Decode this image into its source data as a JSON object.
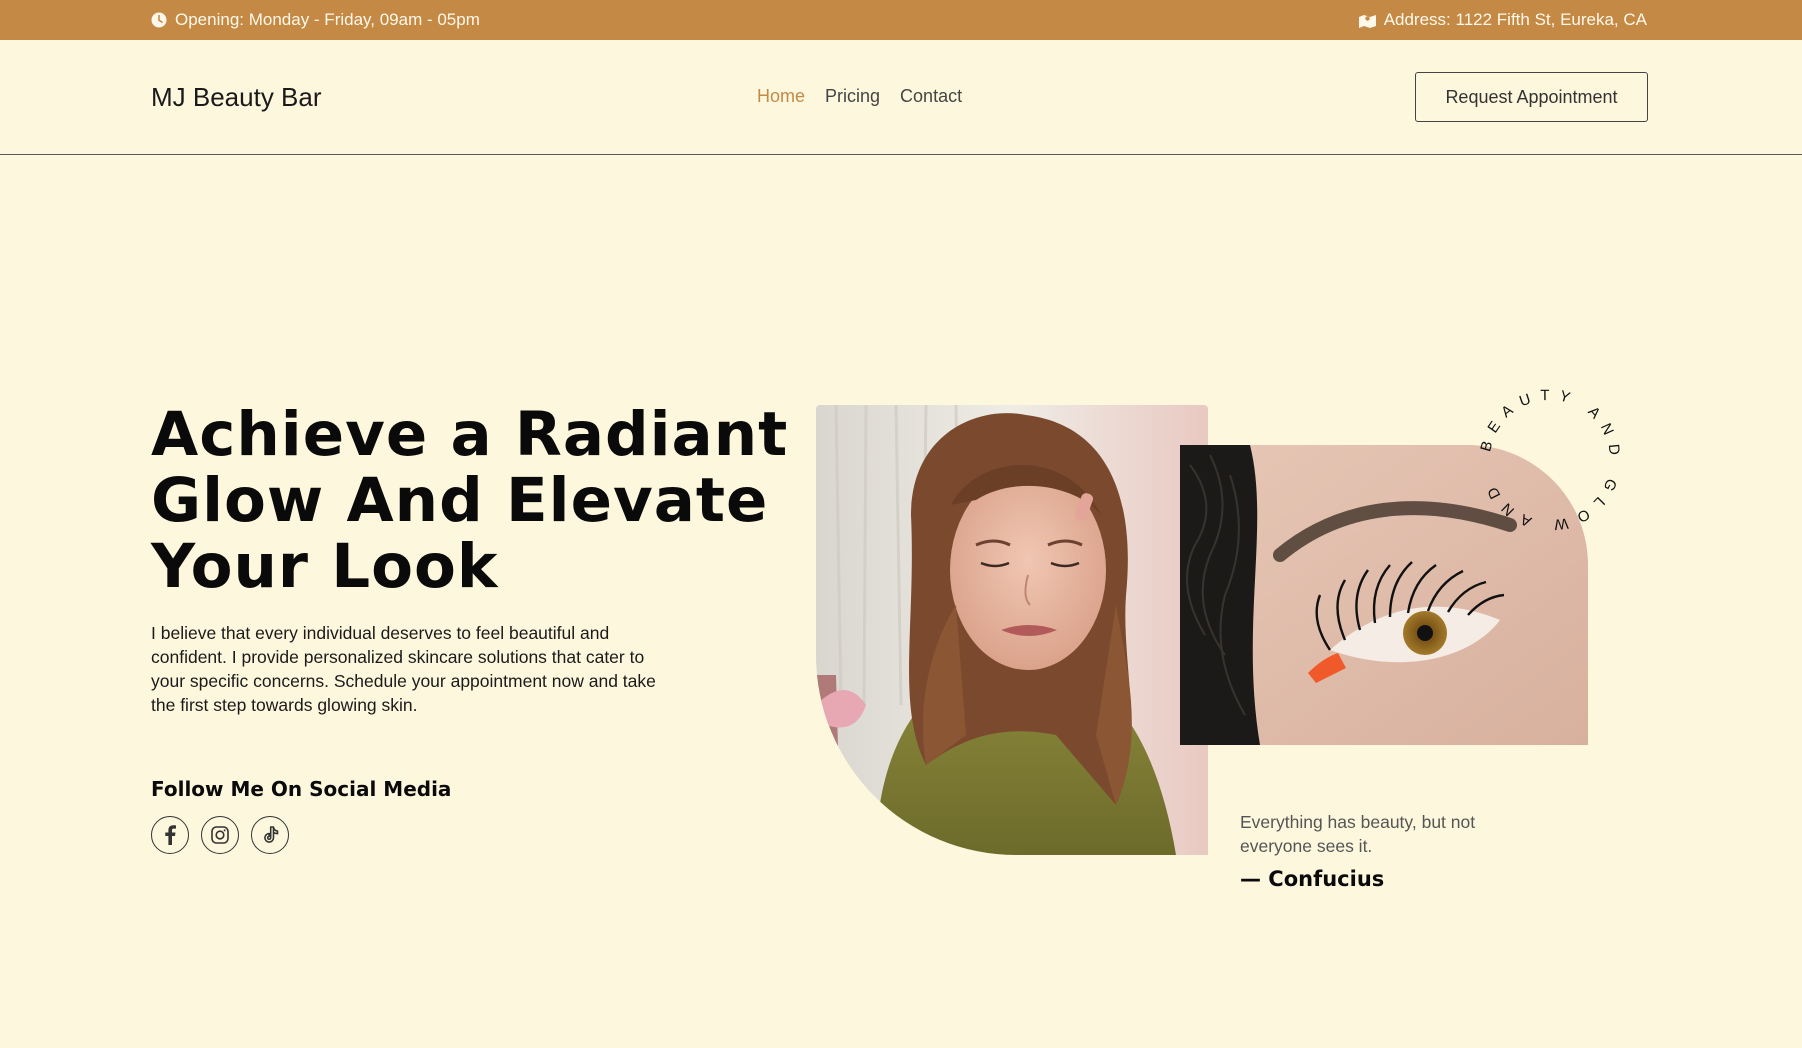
{
  "topbar": {
    "opening": "Opening: Monday - Friday, 09am - 05pm",
    "address": "Address: 1122 Fifth St, Eureka, CA",
    "bg_color": "#c48a45"
  },
  "header": {
    "brand": "MJ Beauty Bar",
    "nav": [
      "Home",
      "Pricing",
      "Contact"
    ],
    "active_nav": "Home",
    "cta_label": "Request Appointment"
  },
  "hero": {
    "title": "Achieve a Radiant Glow And Elevate Your Look",
    "description": "I believe that every individual deserves to feel beautiful and confident. I provide personalized skincare solutions that cater to your specific concerns. Schedule your appointment now and take the first step towards glowing skin.",
    "social_title": "Follow Me On Social Media",
    "socials": [
      "facebook-icon",
      "instagram-icon",
      "tiktok-icon"
    ]
  },
  "badge": {
    "circle_text": "BEAUTY AND GLOW AND"
  },
  "quote": {
    "text": "Everything has beauty, but not everyone sees it.",
    "author": "— Confucius"
  },
  "colors": {
    "background": "#fdf8dd",
    "accent": "#c48a45",
    "text": "#0a0a0a"
  }
}
